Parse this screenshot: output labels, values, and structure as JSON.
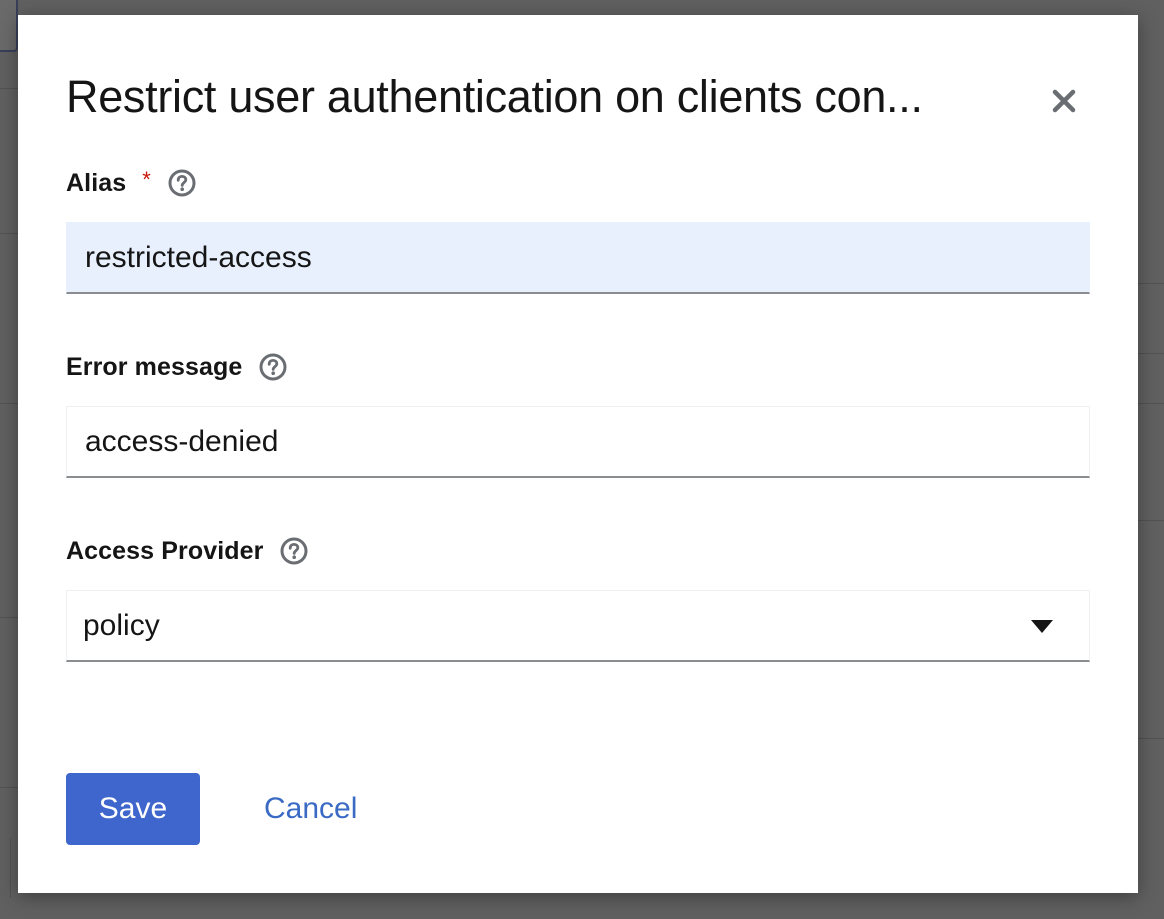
{
  "modal": {
    "title": "Restrict user authentication on clients con...",
    "close_icon": "close-icon"
  },
  "form": {
    "alias": {
      "label": "Alias",
      "required_mark": "*",
      "value": "restricted-access",
      "help_icon": "question-circle-icon"
    },
    "error_message": {
      "label": "Error message",
      "value": "access-denied",
      "help_icon": "question-circle-icon"
    },
    "access_provider": {
      "label": "Access Provider",
      "selected": "policy",
      "help_icon": "question-circle-icon",
      "caret_icon": "caret-down-icon"
    }
  },
  "actions": {
    "save_label": "Save",
    "cancel_label": "Cancel"
  },
  "colors": {
    "primary": "#3e66cc",
    "link": "#3a6ac4",
    "required": "#c9190b",
    "autofill_bg": "#e8f0fe",
    "overlay": "#606060"
  }
}
